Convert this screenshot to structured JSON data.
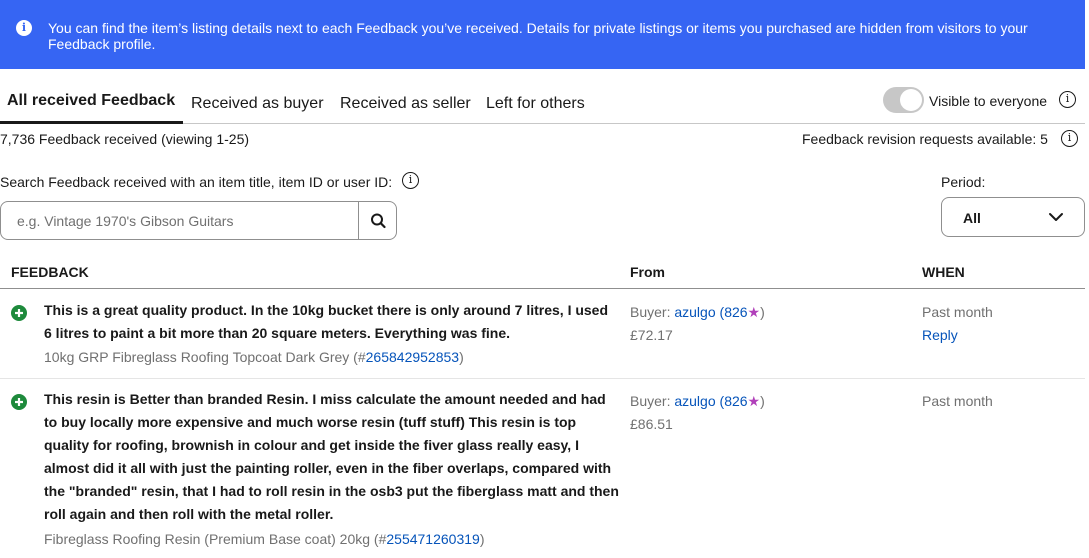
{
  "banner": {
    "icon": "info-icon",
    "message": "You can find the item’s listing details next to each Feedback you’ve received. Details for private listings or items you purchased are hidden from visitors to your Feedback profile."
  },
  "tabs": [
    {
      "label": "All received Feedback",
      "active": true
    },
    {
      "label": "Received as buyer",
      "active": false
    },
    {
      "label": "Received as seller",
      "active": false
    },
    {
      "label": "Left for others",
      "active": false
    }
  ],
  "visibility": {
    "label": "Visible to everyone",
    "on": false
  },
  "summary": {
    "count_text": "7,736 Feedback received (viewing 1-25)",
    "revision_text": "Feedback revision requests available: 5"
  },
  "search": {
    "label": "Search Feedback received with an item title, item ID or user ID:",
    "placeholder": "e.g. Vintage 1970's Gibson Guitars"
  },
  "period": {
    "label": "Period:",
    "selected": "All"
  },
  "table": {
    "headers": {
      "feedback": "FEEDBACK",
      "from": "From",
      "when": "WHEN"
    },
    "rows": [
      {
        "rating": "positive",
        "comment": "This is a great quality product. In the 10kg bucket there is only around 7 litres, I used 6 litres to paint a bit more than 20 square meters. Everything was fine.",
        "item_title": "10kg GRP Fibreglass Roofing Topcoat Dark Grey (#",
        "item_id": "265842952853",
        "item_close": ")",
        "role": "Buyer:",
        "user": "azulgo",
        "score": "826",
        "price": "£72.17",
        "when": "Past month",
        "action": "Reply"
      },
      {
        "rating": "positive",
        "comment": "This resin is Better than branded Resin. I miss calculate the amount needed and had to buy locally more expensive and much worse resin (tuff stuff) This resin is top quality for roofing, brownish in colour and get inside the fiver glass really easy, I almost did it all with just the painting roller, even in the fiber overlaps, compared with the \"branded\" resin, that I had to roll resin in the osb3 put the fiberglass matt and then roll again and then roll with the metal roller.",
        "item_title": "Fibreglass Roofing Resin (Premium Base coat) 20kg (#",
        "item_id": "255471260319",
        "item_close": ")",
        "role": "Buyer:",
        "user": "azulgo",
        "score": "826",
        "price": "£86.51",
        "when": "Past month"
      }
    ]
  },
  "colors": {
    "banner": "#3665f3",
    "link": "#0654ba",
    "positive": "#1e8a3c",
    "star": "#b140ba"
  }
}
